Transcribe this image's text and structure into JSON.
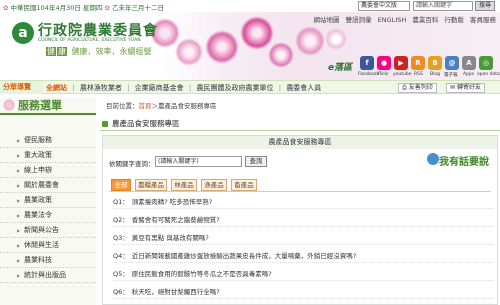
{
  "topbar": {
    "date": "中華民國104年4月30日 星期四",
    "lunar": "乙未年三月十二日",
    "select_value": "農委會中文版",
    "search_placeholder": "請輸入關鍵字",
    "search_btn": "搜尋"
  },
  "header": {
    "links": [
      "網站地圖",
      "雙語詞彙",
      "ENGLISH",
      "農業百科",
      "行動版",
      "客員服務"
    ],
    "logo_mark": "a",
    "title": "行政院農業委員會",
    "subtitle": "COUNCIL OF AGRICULTURE, EXECUTIVE YUAN",
    "slogan_chars": [
      "健",
      "康",
      "效",
      "率"
    ],
    "slogan": "健康．效率．永續經營",
    "e_word": "e落區",
    "e_icons": [
      {
        "name": "facebook",
        "label": "Facebook",
        "color": "#3b5998",
        "glyph": "f"
      },
      {
        "name": "flickr",
        "label": "flickr",
        "color": "#ff0084",
        "glyph": "●"
      },
      {
        "name": "youtube",
        "label": "youtube",
        "color": "#cc2222",
        "glyph": "▶"
      },
      {
        "name": "rss",
        "label": "RSS",
        "color": "#f08a24",
        "glyph": "R"
      },
      {
        "name": "blog",
        "label": "Blog",
        "color": "#e8a020",
        "glyph": "B"
      },
      {
        "name": "epaper",
        "label": "電子報",
        "color": "#4a80c0",
        "glyph": "@"
      },
      {
        "name": "apps",
        "label": "Apps",
        "color": "#888888",
        "glyph": "A"
      },
      {
        "name": "opendata",
        "label": "open data",
        "color": "#4a9a3a",
        "glyph": "◎"
      }
    ]
  },
  "nav": {
    "tab": "分眾導覽",
    "all_site": "全網站",
    "items": [
      "農林漁牧業者",
      "企業廠商基金會",
      "農民團體及政府農業單位",
      "農委會人員"
    ],
    "buttons": [
      "友善列印",
      "轉寄好友"
    ]
  },
  "sidebar": {
    "title": "服務選單",
    "items": [
      "便民服務",
      "重大政策",
      "線上申辦",
      "關於農委會",
      "農業政策",
      "農業法令",
      "新聞與公告",
      "休閒與生活",
      "農業科技",
      "統計與出版品"
    ]
  },
  "main": {
    "breadcrumb_prefix": "目前位置：",
    "breadcrumb_home": "首頁",
    "breadcrumb_rest": "＞農產品食安服務專區",
    "page_title": "農產品食安服務專區",
    "box_title": "農產品食安服務專區",
    "keyword_label": "依關鍵字查詢：",
    "keyword_value": "(請輸入關鍵字)",
    "query_btn": "查詢",
    "ask_label": "我有話要說",
    "tabs": [
      "全部",
      "農糧產品",
      "林產品",
      "漁產品",
      "畜產品"
    ],
    "questions": [
      {
        "n": "Q1：",
        "t": "瀕素瘦肉精? 吃多恐怖早熟?"
      },
      {
        "n": "Q2：",
        "t": "香豬舍有可豬死之龍葵鹼物質?"
      },
      {
        "n": "Q3：",
        "t": "黃豆有黑點 與基改有關嗎?"
      },
      {
        "n": "Q4：",
        "t": "近日新聞報載國產雞炒蛋放檢驗出蔬果皮長件成，大量噴藥，外銷已經沒資嗎?"
      },
      {
        "n": "Q5：",
        "t": "原住民飯食用的假骸竹等冬瓜之不是否具毒素嗎?"
      },
      {
        "n": "Q6：",
        "t": "秋天吃，絕對甘梨觸西行全嗎?"
      }
    ]
  }
}
